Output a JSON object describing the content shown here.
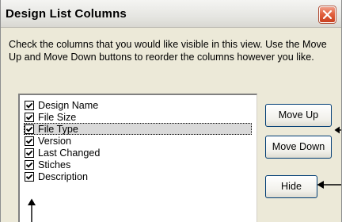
{
  "dialog": {
    "title": "Design List Columns",
    "instructions": "Check the columns that you would like visible in this view. Use the Move Up and Move Down buttons to reorder the columns however you like."
  },
  "columns": [
    {
      "label": "Design Name",
      "checked": true,
      "selected": false
    },
    {
      "label": "File Size",
      "checked": true,
      "selected": false
    },
    {
      "label": "File Type",
      "checked": true,
      "selected": true
    },
    {
      "label": "Version",
      "checked": true,
      "selected": false
    },
    {
      "label": "Last Changed",
      "checked": true,
      "selected": false
    },
    {
      "label": "Stiches",
      "checked": true,
      "selected": false
    },
    {
      "label": "Description",
      "checked": true,
      "selected": false
    }
  ],
  "buttons": {
    "move_up": "Move Up",
    "move_down": "Move Down",
    "hide": "Hide"
  },
  "icons": {
    "close": "close-icon",
    "check": "checkmark-icon",
    "annotation_arrow": "arrow-icon"
  },
  "colors": {
    "close_button": "#e2613f",
    "dialog_background": "#ece9d8",
    "selection_highlight": "#d9d9d9"
  }
}
